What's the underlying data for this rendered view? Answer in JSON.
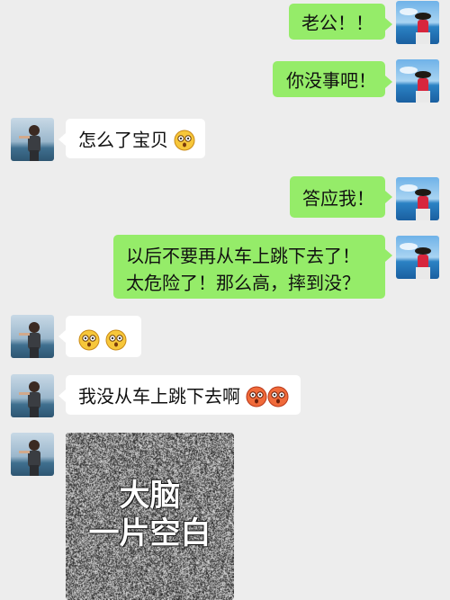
{
  "messages": [
    {
      "side": "out",
      "text": "老公！！"
    },
    {
      "side": "out",
      "text": "你没事吧！"
    },
    {
      "side": "in",
      "text": "怎么了宝贝",
      "emoji": "shocked-face-icon"
    },
    {
      "side": "out",
      "text": "答应我！"
    },
    {
      "side": "out",
      "text": "以后不要再从车上跳下去了！太危险了！那么高，摔到没？"
    },
    {
      "side": "in",
      "emoji_only": [
        "shocked-face-icon",
        "shocked-face-icon"
      ]
    },
    {
      "side": "in",
      "text": "我没从车上跳下去啊",
      "emoji": "angry-face-icon"
    },
    {
      "side": "in",
      "image": {
        "line1": "大脑",
        "line2": "一片空白"
      }
    }
  ],
  "colors": {
    "background": "#ededed",
    "outgoing_bubble": "#95ec69",
    "incoming_bubble": "#ffffff"
  }
}
